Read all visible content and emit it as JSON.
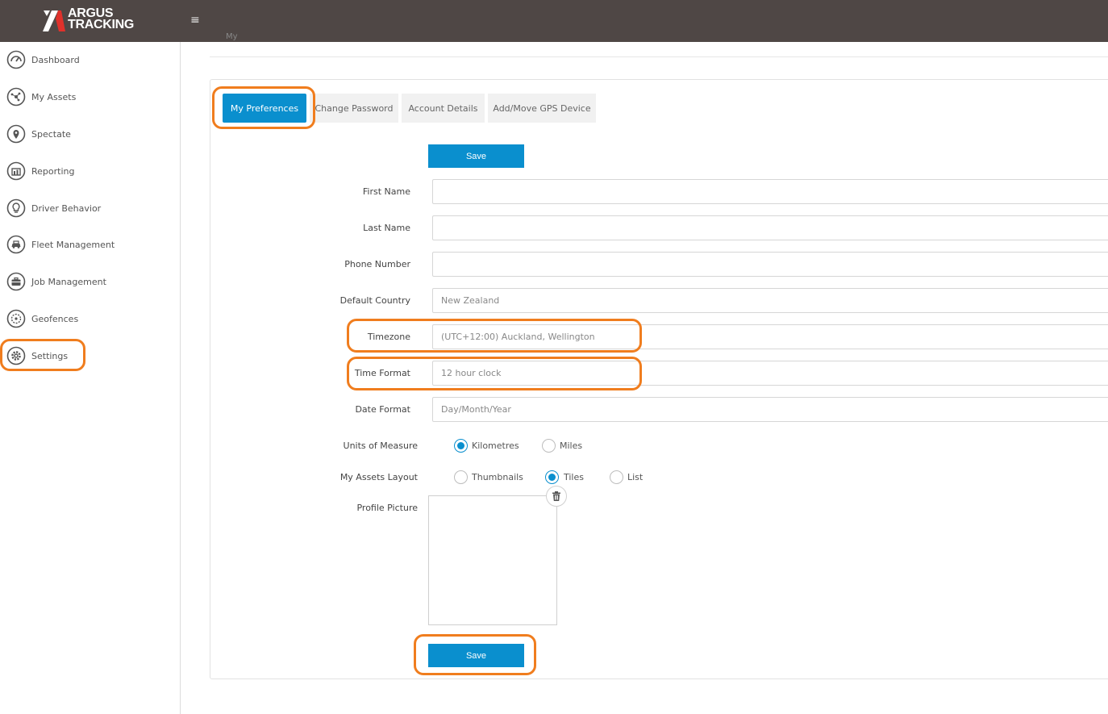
{
  "app": {
    "logo_line1": "ARGUS",
    "logo_line2": "TRACKING",
    "menu_icon": "hamburger-icon"
  },
  "breadcrumb": "My",
  "sidebar": {
    "items": [
      {
        "label": "Dashboard",
        "icon": "gauge-icon"
      },
      {
        "label": "My Assets",
        "icon": "network-icon"
      },
      {
        "label": "Spectate",
        "icon": "map-pin-icon"
      },
      {
        "label": "Reporting",
        "icon": "report-icon"
      },
      {
        "label": "Driver Behavior",
        "icon": "lightbulb-icon"
      },
      {
        "label": "Fleet Management",
        "icon": "car-icon"
      },
      {
        "label": "Job Management",
        "icon": "briefcase-icon"
      },
      {
        "label": "Geofences",
        "icon": "geofence-icon"
      },
      {
        "label": "Settings",
        "icon": "gear-icon"
      }
    ]
  },
  "tabs": [
    {
      "label": "My Preferences",
      "active": true
    },
    {
      "label": "Change Password",
      "active": false
    },
    {
      "label": "Account Details",
      "active": false
    },
    {
      "label": "Add/Move GPS Device",
      "active": false
    }
  ],
  "form": {
    "save_label": "Save",
    "first_name": {
      "label": "First Name",
      "value": ""
    },
    "last_name": {
      "label": "Last Name",
      "value": ""
    },
    "phone_number": {
      "label": "Phone Number",
      "value": ""
    },
    "default_country": {
      "label": "Default Country",
      "value": "New Zealand"
    },
    "timezone": {
      "label": "Timezone",
      "value": "(UTC+12:00) Auckland, Wellington"
    },
    "time_format": {
      "label": "Time Format",
      "value": "12 hour clock"
    },
    "date_format": {
      "label": "Date Format",
      "value": "Day/Month/Year"
    },
    "units": {
      "label": "Units of Measure",
      "options": [
        {
          "label": "Kilometres",
          "checked": true
        },
        {
          "label": "Miles",
          "checked": false
        }
      ]
    },
    "assets_layout": {
      "label": "My Assets Layout",
      "options": [
        {
          "label": "Thumbnails",
          "checked": false
        },
        {
          "label": "Tiles",
          "checked": true
        },
        {
          "label": "List",
          "checked": false
        }
      ]
    },
    "profile_picture": {
      "label": "Profile Picture",
      "delete_icon": "trash-icon"
    }
  },
  "colors": {
    "header_bg": "#4f4745",
    "accent": "#0a8fce",
    "annotation": "#f07d1e",
    "logo_red": "#e0312b"
  }
}
